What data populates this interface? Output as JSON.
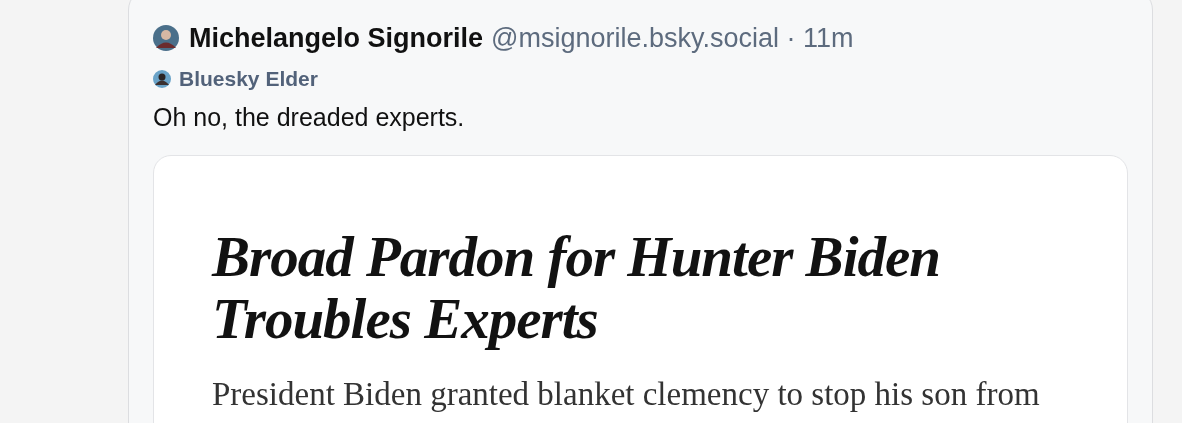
{
  "post": {
    "author": {
      "display_name": "Michelangelo Signorile",
      "handle": "@msignorile.bsky.social",
      "separator": "·",
      "time": "11m"
    },
    "badge": {
      "label": "Bluesky Elder"
    },
    "text": "Oh no, the dreaded experts.",
    "embed": {
      "kind": "article_screenshot",
      "headline_lines": [
        "Broad Pardon for Hunter Biden",
        "Troubles Experts"
      ],
      "summary": "President Biden granted blanket clemency to stop his son from"
    }
  }
}
